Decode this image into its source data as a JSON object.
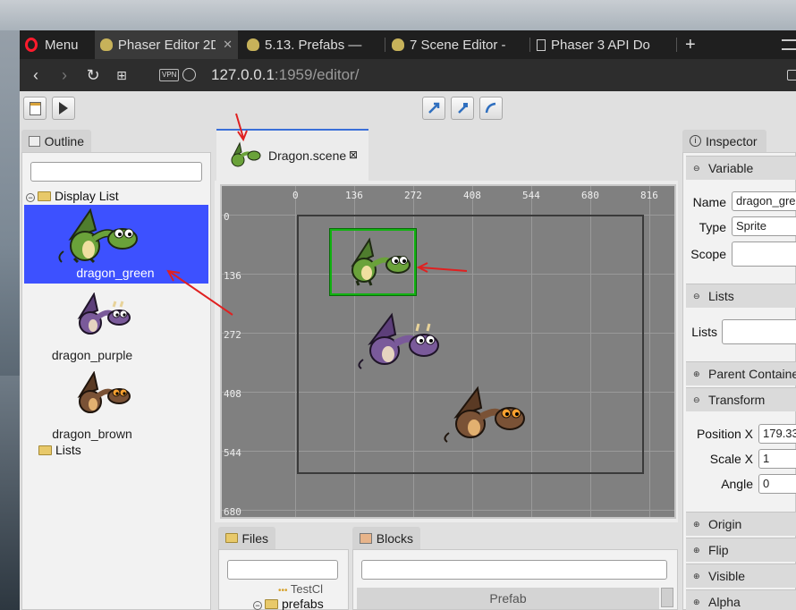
{
  "browser": {
    "menu_label": "Menu",
    "tabs": [
      {
        "label": "Phaser Editor 2D"
      },
      {
        "label": "5.13. Prefabs —"
      },
      {
        "label": "7  Scene Editor -"
      },
      {
        "label": "Phaser 3 API Do"
      }
    ],
    "new_tab": "+",
    "url_host": "127.0.0.1",
    "url_rest": ":1959/editor/",
    "vpn": "VPN"
  },
  "outline": {
    "tab_label": "Outline",
    "display_list": "Display List",
    "items": [
      {
        "label": "dragon_green",
        "color": "#5a9a3a"
      },
      {
        "label": "dragon_purple",
        "color": "#7a5a9a"
      },
      {
        "label": "dragon_brown",
        "color": "#7a5236"
      }
    ],
    "lists": "Lists"
  },
  "scene": {
    "tab_label": "Dragon.scene",
    "x_ticks": [
      "0",
      "136",
      "272",
      "408",
      "544",
      "680",
      "816"
    ],
    "y_ticks": [
      "0",
      "136",
      "272",
      "408",
      "544",
      "680"
    ]
  },
  "files": {
    "tab_label": "Files",
    "partial_item": "TestCl",
    "folder_item": "prefabs"
  },
  "blocks": {
    "tab_label": "Blocks",
    "header": "Prefab"
  },
  "inspector": {
    "tab_label": "Inspector",
    "sections": {
      "variable": "Variable",
      "lists": "Lists",
      "parent": "Parent Containe",
      "transform": "Transform",
      "origin": "Origin",
      "flip": "Flip",
      "visible": "Visible",
      "alpha": "Alpha"
    },
    "name_label": "Name",
    "name_value": "dragon_gre",
    "type_label": "Type",
    "type_value": "Sprite",
    "scope_label": "Scope",
    "lists_label": "Lists",
    "position_label": "Position",
    "position_x_label": "X",
    "position_x_value": "179.33",
    "scale_label": "Scale",
    "scale_x_label": "X",
    "scale_x_value": "1",
    "angle_label": "Angle",
    "angle_value": "0"
  },
  "colors": {
    "selection": "#3d51ff",
    "accent_arrow": "#e02020"
  }
}
